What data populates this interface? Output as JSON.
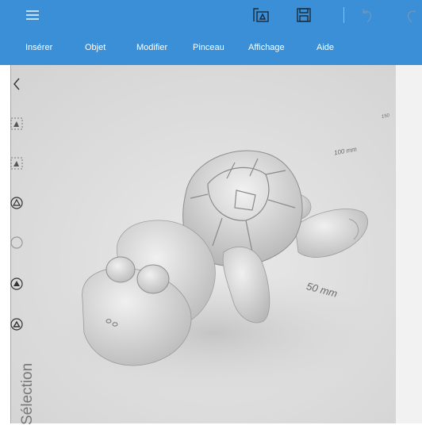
{
  "toolbar": {
    "icons": [
      "hamburger-icon",
      "print-3d-icon",
      "save-icon",
      "undo-icon",
      "redo-icon"
    ]
  },
  "menu": {
    "items": [
      "Insérer",
      "Objet",
      "Modifier",
      "Pinceau",
      "Affichage",
      "Aide"
    ]
  },
  "viewport": {
    "ruler_labels": [
      "150",
      "100 mm",
      "50 mm"
    ]
  },
  "side_panel": {
    "icons": [
      "collapse-chevron-icon",
      "select-object-icon",
      "select-object-alt-icon",
      "triangle-select-icon",
      "radio-circle-icon",
      "triangle-paint-icon",
      "triangle-outline-icon"
    ],
    "label": "Sélection"
  },
  "colors": {
    "accent": "#3a8fd6",
    "viewport_bg": "#dedede",
    "panel_bg": "#f2f2f2"
  }
}
